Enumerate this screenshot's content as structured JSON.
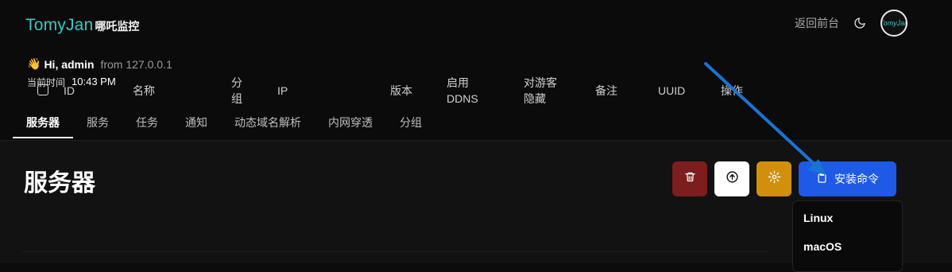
{
  "brand": {
    "name": "TomyJan",
    "subtitle": "哪吒监控"
  },
  "header": {
    "greeting": "Hi, admin",
    "from": "from 127.0.0.1",
    "time_label": "当前时间",
    "time_value": "10:43 PM",
    "back_link": "返回前台",
    "avatar_text": "TomyJan"
  },
  "tabs": [
    {
      "label": "服务器",
      "active": true
    },
    {
      "label": "服务",
      "active": false
    },
    {
      "label": "任务",
      "active": false
    },
    {
      "label": "通知",
      "active": false
    },
    {
      "label": "动态域名解析",
      "active": false
    },
    {
      "label": "内网穿透",
      "active": false
    },
    {
      "label": "分组",
      "active": false
    }
  ],
  "page": {
    "title": "服务器"
  },
  "actions": {
    "delete_icon": "trash-icon",
    "upload_icon": "arrow-up-circle-icon",
    "settings_icon": "gear-icon",
    "install_label": "安装命令",
    "install_icon": "clipboard-icon"
  },
  "table": {
    "columns": {
      "id": "ID",
      "name": "名称",
      "group": "分组",
      "ip": "IP",
      "version": "版本",
      "ddns": "启用 DDNS",
      "hide": "对游客隐藏",
      "note": "备注",
      "uuid": "UUID",
      "ops": "操作"
    }
  },
  "dropdown": {
    "items": [
      "Linux",
      "macOS"
    ]
  },
  "colors": {
    "accent": "#1e5ae6",
    "brand": "#3ec7c7",
    "danger": "#7d1d1d",
    "warning": "#d28f0b",
    "annotation_arrow": "#1a73d4"
  }
}
